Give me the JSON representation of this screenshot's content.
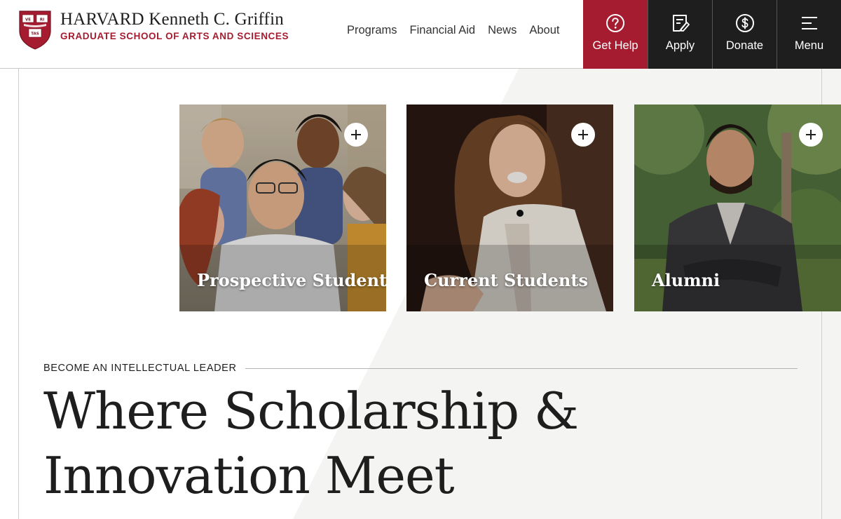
{
  "header": {
    "logo": {
      "wordmark": "HARVARD Kenneth C. Griffin",
      "subtitle": "GRADUATE SCHOOL OF ARTS AND SCIENCES",
      "shield_text": [
        "VE",
        "RI",
        "TAS"
      ]
    },
    "nav": [
      {
        "label": "Programs"
      },
      {
        "label": "Financial Aid"
      },
      {
        "label": "News"
      },
      {
        "label": "About"
      }
    ],
    "actions": [
      {
        "label": "Get Help",
        "icon": "question-circle-icon"
      },
      {
        "label": "Apply",
        "icon": "document-pen-icon"
      },
      {
        "label": "Donate",
        "icon": "dollar-circle-icon"
      },
      {
        "label": "Menu",
        "icon": "hamburger-menu-icon"
      }
    ]
  },
  "cards": [
    {
      "label": "Prospective Students",
      "icon": "plus-icon"
    },
    {
      "label": "Current Students",
      "icon": "plus-icon"
    },
    {
      "label": "Alumni",
      "icon": "plus-icon"
    }
  ],
  "hero": {
    "eyebrow": "BECOME AN INTELLECTUAL LEADER",
    "title_line1": "Where Scholarship &",
    "title_line2": "Innovation Meet"
  },
  "colors": {
    "crimson": "#a51c30",
    "dark": "#1e1e1e",
    "diagonal_band": "#f4f4f2"
  }
}
